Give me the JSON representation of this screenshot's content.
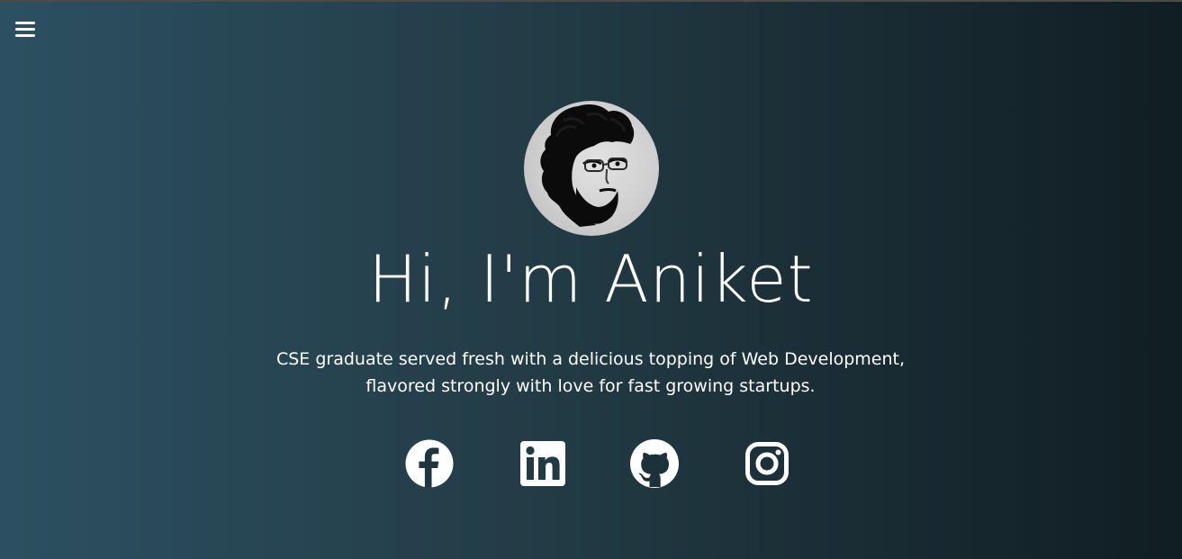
{
  "nav": {
    "menu_icon": "hamburger-menu-icon"
  },
  "hero": {
    "avatar_icon": "profile-photo",
    "headline": "Hi, I'm Aniket",
    "tagline_lines": [
      "CSE graduate served fresh with a delicious topping of Web Development,",
      "flavored strongly with love for fast growing startups."
    ]
  },
  "social_links": [
    {
      "icon": "facebook-icon"
    },
    {
      "icon": "linkedin-icon"
    },
    {
      "icon": "github-icon"
    },
    {
      "icon": "instagram-icon"
    }
  ],
  "colors": {
    "background_left": "#2c5062",
    "background_right": "#101e23",
    "text": "#ffffff"
  }
}
